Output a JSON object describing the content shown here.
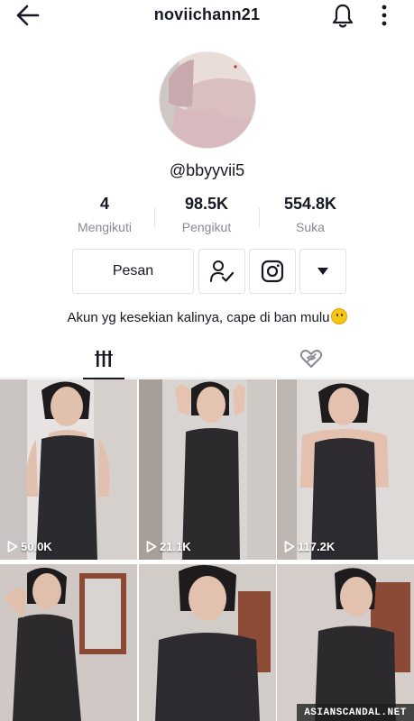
{
  "header": {
    "username": "noviichann21"
  },
  "profile": {
    "handle": "@bbyyvii5",
    "bio": "Akun yg kesekian kalinya, cape di ban mulu",
    "bio_emoji": "slightly-smiling-face"
  },
  "stats": [
    {
      "value": "4",
      "label": "Mengikuti"
    },
    {
      "value": "98.5K",
      "label": "Pengikut"
    },
    {
      "value": "554.8K",
      "label": "Suka"
    }
  ],
  "actions": {
    "message_label": "Pesan",
    "icons": [
      "following-check-icon",
      "instagram-icon",
      "dropdown-arrow-icon"
    ]
  },
  "tabs": [
    {
      "name": "videos",
      "icon": "grid-columns-icon",
      "active": true
    },
    {
      "name": "liked",
      "icon": "hidden-heart-icon",
      "active": false
    }
  ],
  "videos": [
    {
      "views": "50.0K"
    },
    {
      "views": "21.1K"
    },
    {
      "views": "117.2K"
    },
    {
      "views": ""
    },
    {
      "views": ""
    },
    {
      "views": ""
    }
  ],
  "watermark": "ASIANSCANDAL.NET",
  "colors": {
    "text": "#161823",
    "muted": "#8a8b91",
    "border": "#e3e3e4"
  }
}
